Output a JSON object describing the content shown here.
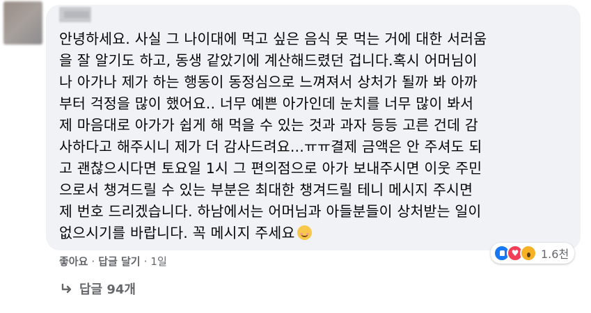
{
  "comment": {
    "lines": [
      "안녕하세요. 사실 그 나이대에 먹고 싶은 음식 못 먹는 거에 대한 서러움",
      "을 잘 알기도 하고, 동생 같았기에 계산해드렸던 겁니다.혹시 어머님이",
      "나 아가나 제가 하는 행동이 동정심으로 느껴져서 상처가 될까 봐 아까",
      "부터 걱정을 많이 했어요.. 너무 예쁜 아가인데 눈치를 너무 많이 봐서",
      "제 마음대로 아가가 쉽게 해 먹을 수 있는 것과 과자 등등 고른 건데 감",
      "사하다고 해주시니 제가 더 감사드려요...ㅠㅠ결제 금액은 안 주셔도 되",
      "고 괜찮으시다면 토요일 1시 그 편의점으로 아가 보내주시면 이웃 주민",
      "으로서 챙겨드릴 수 있는 부분은 최대한 챙겨드릴 테니 메시지 주시면",
      "제 번호 드리겠습니다. 하남에서는 어머님과 아들분들이 상처받는 일이",
      "없으시기를 바랍니다. 꼭 메시지 주세요"
    ],
    "trailing_emoji": "smiling-face-emoji"
  },
  "reactions": {
    "icons": [
      "like-icon",
      "love-icon",
      "wow-icon"
    ],
    "count": "1.6천"
  },
  "meta": {
    "like_label": "좋아요",
    "separator": "·",
    "reply_label": "답글 달기",
    "time": "1일"
  },
  "replies": {
    "label": "답글 94개"
  },
  "colors": {
    "bubble": "#f0f2f5",
    "text": "#050505",
    "secondary": "#65676b",
    "like": "#1877f2",
    "love": "#f33e58",
    "wow": "#f7b125"
  }
}
